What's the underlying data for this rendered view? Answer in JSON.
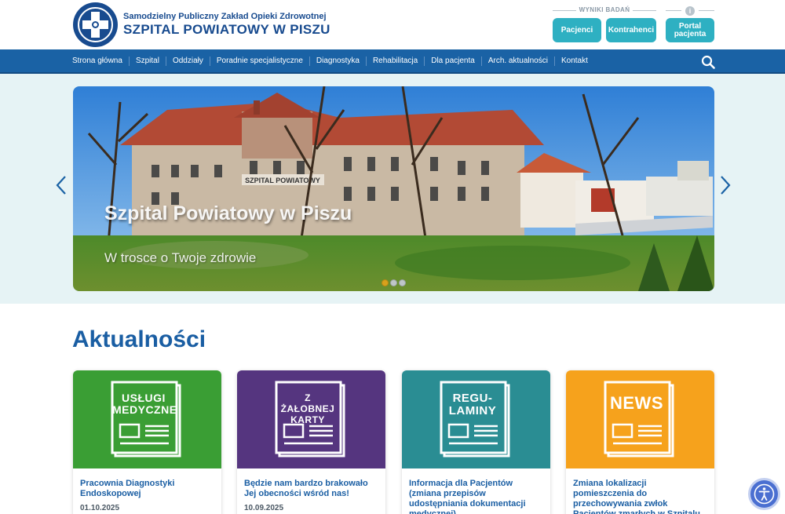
{
  "header": {
    "org_line": "Samodzielny Publiczny Zakład Opieki Zdrowotnej",
    "hospital_name": "SZPITAL POWIATOWY W PISZU",
    "results_label": "WYNIKI BADAŃ",
    "buttons": {
      "patients": "Pacjenci",
      "contractors": "Kontrahenci",
      "portal": "Portal pacjenta"
    },
    "info_icon": "info-icon"
  },
  "nav": {
    "items": [
      "Strona główna",
      "Szpital",
      "Oddziały",
      "Poradnie specjalistyczne",
      "Diagnostyka",
      "Rehabilitacja",
      "Dla pacjenta",
      "Arch. aktualności",
      "Kontakt"
    ],
    "search_icon": "search-icon"
  },
  "slider": {
    "building_sign": "SZPITAL POWIATOWY",
    "caption": "Szpital Powiatowy w Piszu",
    "subcaption": "W trosce o Twoje zdrowie",
    "dots": 3,
    "active_dot": 1
  },
  "news": {
    "heading": "Aktualności",
    "cards": [
      {
        "paper_text": "USŁUGI MEDYCZNE",
        "title": "Pracownia Diagnostyki Endoskopowej",
        "date": "01.10.2025",
        "color": "#3a9e34"
      },
      {
        "paper_text": "Z ŻAŁOBNEJ KARTY",
        "title": "Będzie nam bardzo brakowało Jej obecności wśród nas!",
        "date": "10.09.2025",
        "color": "#55357f"
      },
      {
        "paper_text": "REGU- LAMINY",
        "title": "Informacja dla Pacjentów (zmiana przepisów udostępniania dokumentacji medycznej)",
        "date": "",
        "color": "#2a8d93"
      },
      {
        "paper_text": "NEWS",
        "title": "Zmiana lokalizacji pomieszczenia do przechowywania zwłok Pacjentów zmarłych w Szpitalu",
        "date": "",
        "color": "#f6a21c"
      }
    ]
  },
  "accessibility": {
    "icon": "accessibility-icon"
  },
  "colors": {
    "brand_blue": "#184b8f",
    "nav_blue": "#1a62a5",
    "teal_button": "#2eb0c2",
    "heading_blue": "#1a5ea3"
  }
}
